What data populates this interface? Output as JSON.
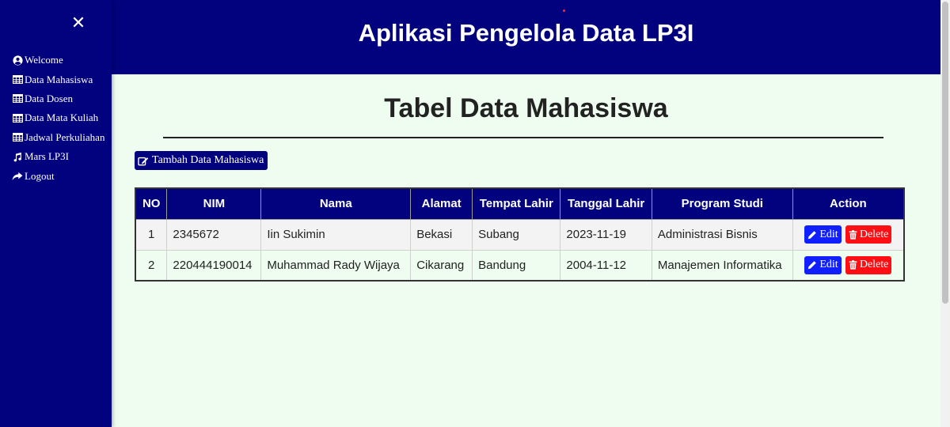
{
  "header": {
    "title": "Aplikasi Pengelola Data LP3I"
  },
  "sidebar": {
    "close_label": "✕",
    "items": [
      {
        "label": "Welcome",
        "icon": "user-circle-icon"
      },
      {
        "label": "Data Mahasiswa",
        "icon": "table-icon"
      },
      {
        "label": "Data Dosen",
        "icon": "table-icon"
      },
      {
        "label": "Data Mata Kuliah",
        "icon": "table-icon"
      },
      {
        "label": "Jadwal Perkuliahan",
        "icon": "table-icon"
      },
      {
        "label": "Mars LP3I",
        "icon": "music-icon"
      },
      {
        "label": "Logout",
        "icon": "share-icon"
      }
    ]
  },
  "main": {
    "page_title": "Tabel Data Mahasiswa",
    "add_button_label": "Tambah Data Mahasiswa",
    "table": {
      "headers": [
        "NO",
        "NIM",
        "Nama",
        "Alamat",
        "Tempat Lahir",
        "Tanggal Lahir",
        "Program Studi",
        "Action"
      ],
      "rows": [
        {
          "no": "1",
          "nim": "2345672",
          "nama": "Iin Sukimin",
          "alamat": "Bekasi",
          "tempat_lahir": "Subang",
          "tanggal_lahir": "2023-11-19",
          "program_studi": "Administrasi Bisnis"
        },
        {
          "no": "2",
          "nim": "220444190014",
          "nama": "Muhammad Rady Wijaya",
          "alamat": "Cikarang",
          "tempat_lahir": "Bandung",
          "tanggal_lahir": "2004-11-12",
          "program_studi": "Manajemen Informatika"
        }
      ],
      "edit_label": "Edit",
      "delete_label": "Delete"
    }
  },
  "colors": {
    "navy": "#02027f",
    "background": "#eefdf0",
    "edit": "#0f1fff",
    "delete": "#ff0f14"
  }
}
